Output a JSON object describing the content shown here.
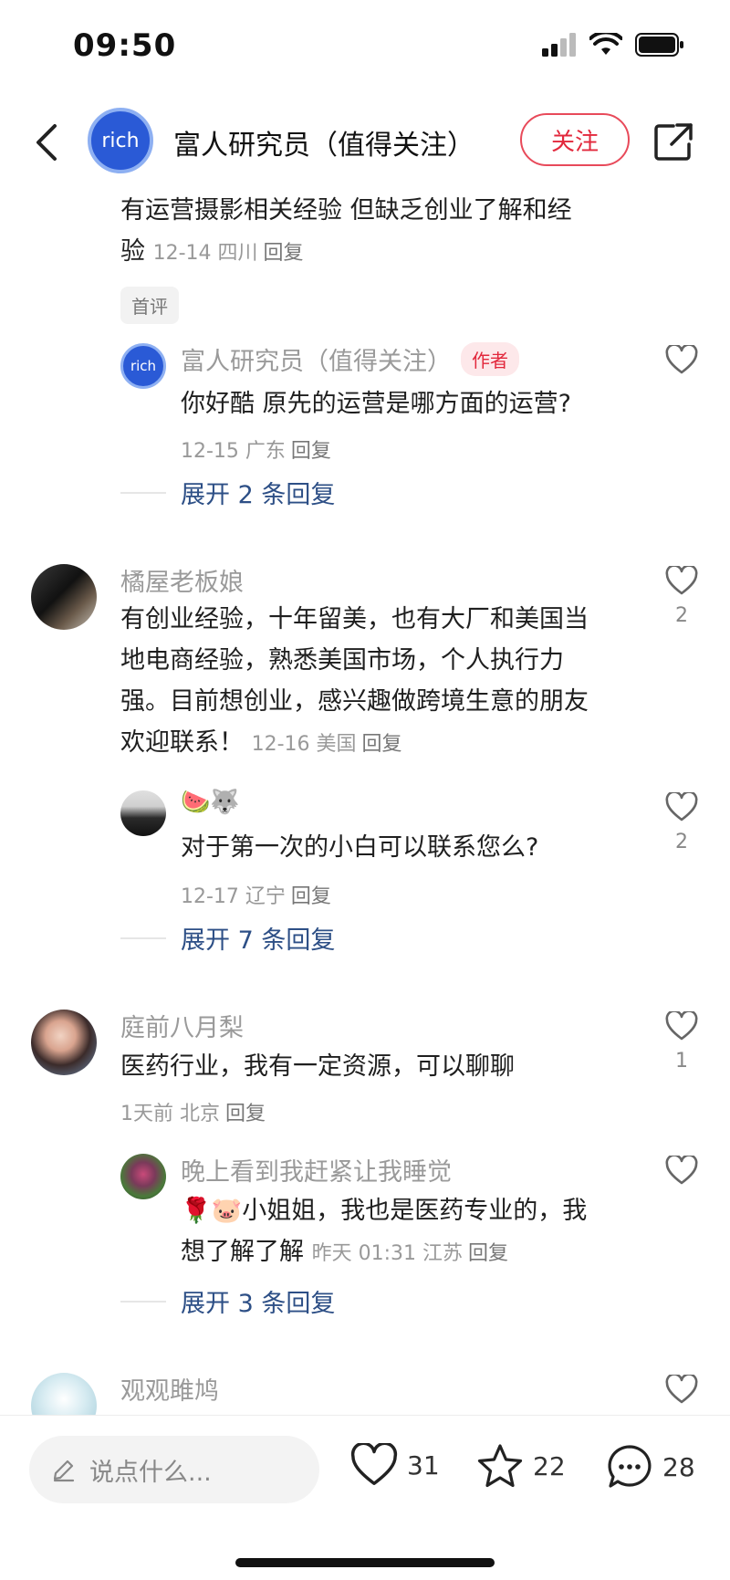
{
  "status": {
    "time": "09:50"
  },
  "header": {
    "avatar_text": "rich",
    "name": "富人研究员（值得关注）",
    "follow": "关注"
  },
  "comments": {
    "c1": {
      "text_line1": "有运营摄影相关经验 但缺乏创业了解和经",
      "text_line2": "验",
      "meta": "12-14 四川",
      "reply": "回复",
      "tag": "首评",
      "sub": {
        "avatar_text": "rich",
        "name": "富人研究员（值得关注）",
        "badge": "作者",
        "text": "你好酷 原先的运营是哪方面的运营?",
        "meta": "12-15 广东",
        "reply": "回复"
      },
      "expand": "展开 2 条回复"
    },
    "c2": {
      "name": "橘屋老板娘",
      "lines": [
        "有创业经验，十年留美，也有大厂和美国当",
        "地电商经验，熟悉美国市场，个人执行力",
        "强。目前想创业，感兴趣做跨境生意的朋友"
      ],
      "last_line": "欢迎联系！",
      "meta": "12-16 美国",
      "reply": "回复",
      "likes": "2",
      "sub": {
        "name": "🍉🐺",
        "text": "对于第一次的小白可以联系您么?",
        "meta": "12-17 辽宁",
        "reply": "回复",
        "likes": "2"
      },
      "expand": "展开 7 条回复"
    },
    "c3": {
      "name": "庭前八月梨",
      "text": "医药行业，我有一定资源，可以聊聊",
      "meta": "1天前 北京",
      "reply": "回复",
      "likes": "1",
      "sub": {
        "name": "晚上看到我赶紧让我睡觉",
        "line1": "🌹🐷小姐姐，我也是医药专业的，我",
        "line2": "想了解了解",
        "meta": "昨天 01:31 江苏",
        "reply": "回复"
      },
      "expand": "展开 3 条回复"
    },
    "c4": {
      "name": "观观雎鸠"
    }
  },
  "bottom": {
    "placeholder": "说点什么...",
    "likes": "31",
    "stars": "22",
    "comments": "28"
  },
  "icons": {
    "back": "chevron-left-icon",
    "share": "share-icon",
    "like": "heart-icon",
    "star": "star-icon",
    "comment": "comment-bubble-icon",
    "edit": "pencil-icon"
  },
  "colors": {
    "accent_red": "#e2283c",
    "link_blue": "#2d4f86",
    "avatar_blue": "#2a5ad6"
  }
}
